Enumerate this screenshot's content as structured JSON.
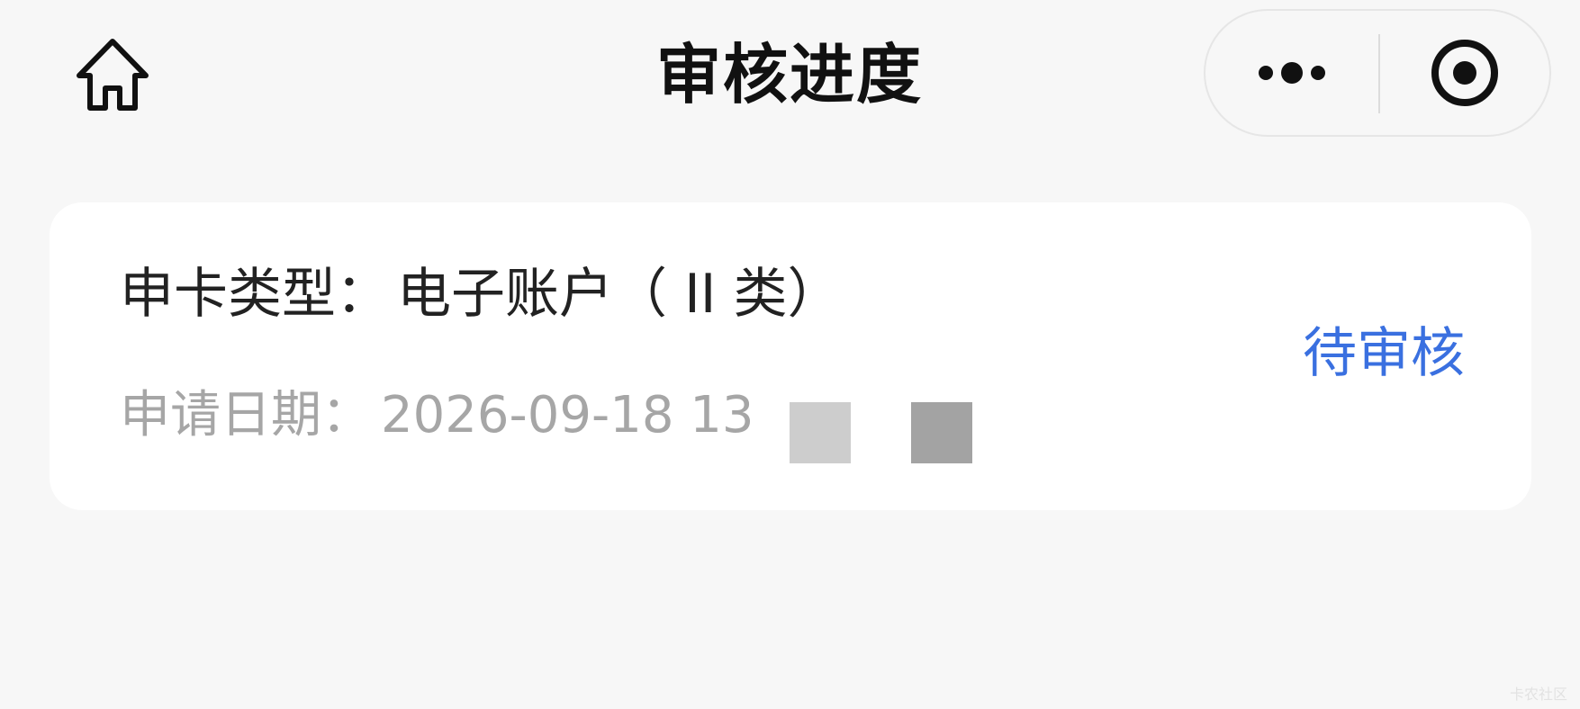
{
  "nav": {
    "title": "审核进度",
    "home_icon": "home-icon",
    "more_icon": "more-dots-icon",
    "close_icon": "target-close-icon"
  },
  "card": {
    "title_label": "申卡类型：",
    "title_value": "电子账户（ II 类）",
    "date_label": "申请日期：",
    "date_value": "2026-09-18 13",
    "status": "待审核"
  },
  "watermark": "卡农社区",
  "colors": {
    "background": "#f7f7f7",
    "card": "#ffffff",
    "status": "#3a70e0",
    "title_text": "#111111",
    "secondary_text": "#a6a6a6"
  }
}
